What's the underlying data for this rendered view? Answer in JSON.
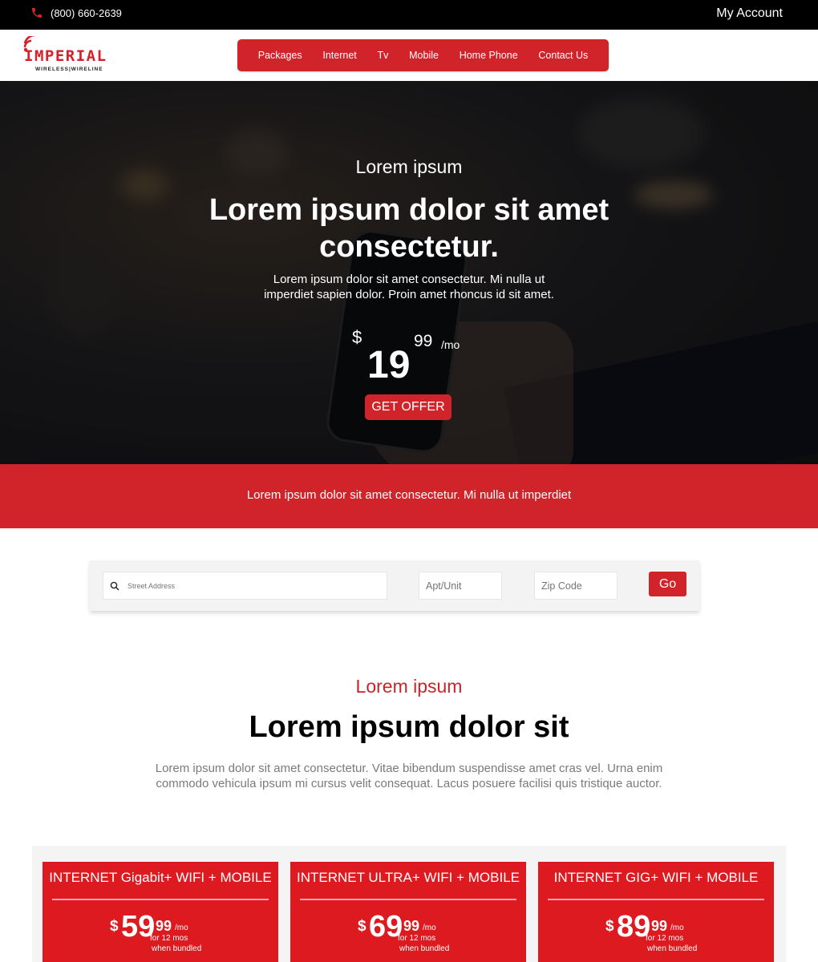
{
  "topbar": {
    "phone": "(800) 660-2639",
    "account": "My Account"
  },
  "logo": {
    "brand": "IMPERIAL",
    "tagline": "WIRELESS|WIRELINE"
  },
  "nav": {
    "items": [
      {
        "label": "Packages"
      },
      {
        "label": "Internet"
      },
      {
        "label": "Tv"
      },
      {
        "label": "Mobile"
      },
      {
        "label": "Home Phone"
      },
      {
        "label": "Contact Us"
      }
    ]
  },
  "hero": {
    "eyebrow": "Lorem ipsum",
    "headline_line1": "Lorem ipsum dolor sit amet",
    "headline_line2": "consectetur.",
    "desc_line1": "Lorem ipsum dolor sit amet consectetur. Mi nulla ut",
    "desc_line2": "imperdiet sapien dolor. Proin amet rhoncus id sit amet.",
    "price": {
      "currency": "$",
      "dollars": "19",
      "cents": "99",
      "per": "/mo"
    },
    "cta": "GET OFFER"
  },
  "banner": {
    "text": "Lorem ipsum dolor sit amet consectetur. Mi nulla ut imperdiet"
  },
  "search": {
    "street_placeholder": "Street Address",
    "apt_placeholder": "Apt/Unit",
    "zip_placeholder": "Zip Code",
    "go": "Go"
  },
  "section": {
    "eyebrow": "Lorem ipsum",
    "title": "Lorem ipsum dolor sit",
    "desc_line1": "Lorem ipsum dolor sit amet consectetur. Vitae bibendum suspendisse amet cras vel. Urna enim",
    "desc_line2": "commodo vehicula ipsum mi cursus velit consequat. Lacus posuere facilisi quis tristique auctor."
  },
  "plans": [
    {
      "name": "INTERNET Gigabit+ WIFI + MOBILE",
      "currency": "$",
      "dollars": "59",
      "cents": "99",
      "per": "/mo",
      "term": "for 12 mos",
      "note": "when bundled"
    },
    {
      "name": "INTERNET ULTRA+ WIFI + MOBILE",
      "currency": "$",
      "dollars": "69",
      "cents": "99",
      "per": "/mo",
      "term": "for 12 mos",
      "note": "when bundled"
    },
    {
      "name": "INTERNET GIG+ WIFI + MOBILE",
      "currency": "$",
      "dollars": "89",
      "cents": "99",
      "per": "/mo",
      "term": "for 12 mos",
      "note": "when bundled"
    }
  ],
  "colors": {
    "brand_red": "#d0232a",
    "plan_red": "#dd1a20",
    "topbar": "#000000"
  },
  "icons": {
    "phone": "phone-icon",
    "search": "search-icon",
    "logo": "wifi-signal-icon"
  }
}
